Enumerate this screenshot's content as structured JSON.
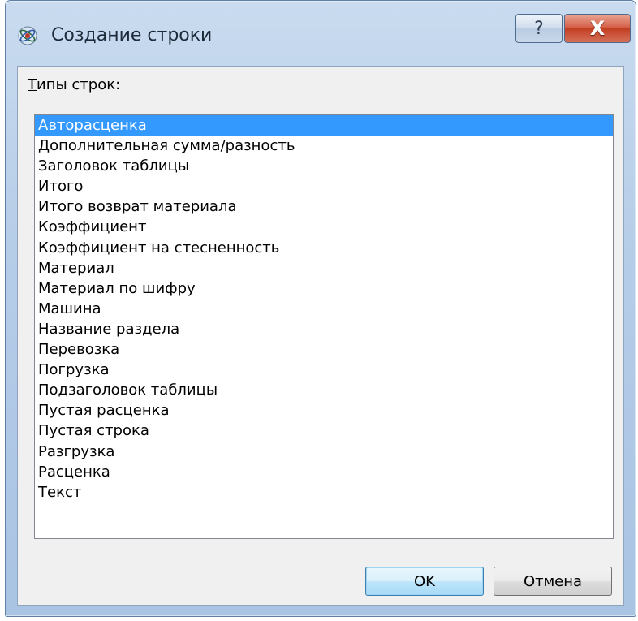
{
  "window": {
    "title": "Создание строки",
    "help_label": "?",
    "close_label": "X"
  },
  "dialog": {
    "label_mnemonic": "Т",
    "label_rest": "ипы строк:",
    "selected_index": 0,
    "items": [
      "Авторасценка",
      "Дополнительная сумма/разность",
      "Заголовок таблицы",
      "Итого",
      "Итого возврат материала",
      "Коэффициент",
      "Коэффициент на стесненность",
      "Материал",
      "Материал по шифру",
      "Машина",
      "Название раздела",
      "Перевозка",
      "Погрузка",
      "Подзаголовок таблицы",
      "Пустая расценка",
      "Пустая строка",
      "Разгрузка",
      "Расценка",
      "Текст"
    ],
    "ok_label": "OK",
    "cancel_label": "Отмена"
  },
  "colors": {
    "selection": "#3399ff",
    "close_button": "#c23e21"
  },
  "icons": {
    "app": "app-atom-icon"
  }
}
